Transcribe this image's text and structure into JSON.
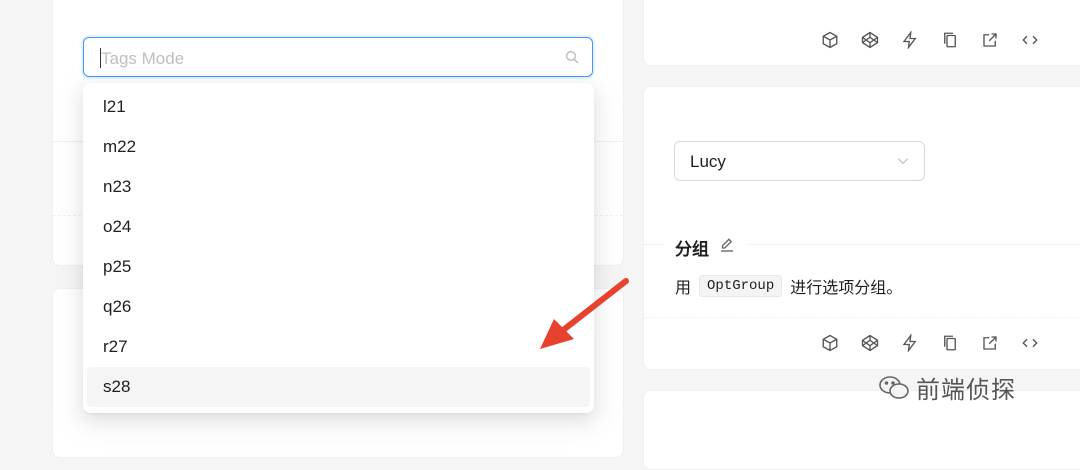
{
  "tags_select": {
    "placeholder": "Tags Mode"
  },
  "dropdown": {
    "options": [
      {
        "label": "l21"
      },
      {
        "label": "m22"
      },
      {
        "label": "n23"
      },
      {
        "label": "o24"
      },
      {
        "label": "p25"
      },
      {
        "label": "q26"
      },
      {
        "label": "r27"
      },
      {
        "label": "s28"
      }
    ],
    "active_index": 7
  },
  "lucy_select": {
    "value": "Lucy"
  },
  "section": {
    "title": "分组",
    "desc_prefix": "用",
    "desc_code": "OptGroup",
    "desc_suffix": "进行选项分组。"
  },
  "action_icons": [
    "codesandbox-icon",
    "codepen-icon",
    "stackblitz-icon",
    "copy-icon",
    "open-external-icon",
    "code-icon"
  ],
  "colors": {
    "focus_border": "#4096ff",
    "arrow": "#e8412d",
    "active_option_bg": "#f5f5f5"
  },
  "watermark": {
    "text": "前端侦探"
  }
}
